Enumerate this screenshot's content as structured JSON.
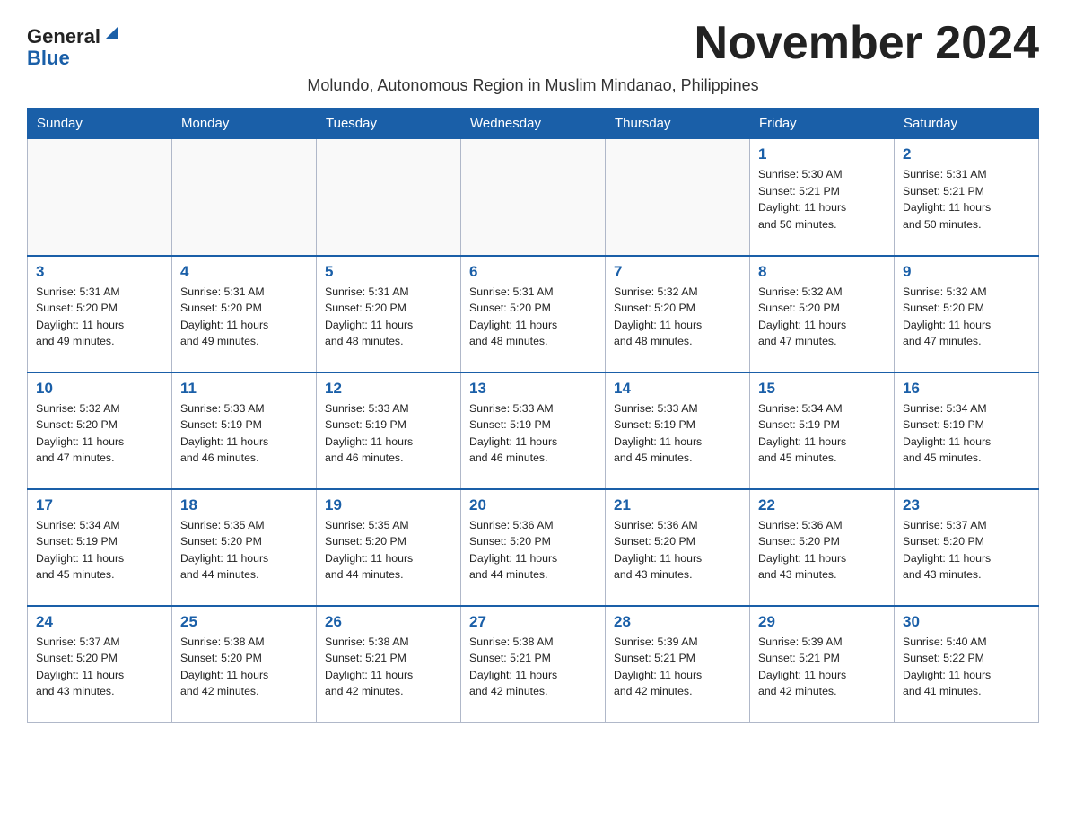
{
  "logo": {
    "general": "General",
    "blue": "Blue",
    "aria": "GeneralBlue logo"
  },
  "title": "November 2024",
  "subtitle": "Molundo, Autonomous Region in Muslim Mindanao, Philippines",
  "days_of_week": [
    "Sunday",
    "Monday",
    "Tuesday",
    "Wednesday",
    "Thursday",
    "Friday",
    "Saturday"
  ],
  "weeks": [
    {
      "days": [
        {
          "num": "",
          "info": ""
        },
        {
          "num": "",
          "info": ""
        },
        {
          "num": "",
          "info": ""
        },
        {
          "num": "",
          "info": ""
        },
        {
          "num": "",
          "info": ""
        },
        {
          "num": "1",
          "info": "Sunrise: 5:30 AM\nSunset: 5:21 PM\nDaylight: 11 hours\nand 50 minutes."
        },
        {
          "num": "2",
          "info": "Sunrise: 5:31 AM\nSunset: 5:21 PM\nDaylight: 11 hours\nand 50 minutes."
        }
      ]
    },
    {
      "days": [
        {
          "num": "3",
          "info": "Sunrise: 5:31 AM\nSunset: 5:20 PM\nDaylight: 11 hours\nand 49 minutes."
        },
        {
          "num": "4",
          "info": "Sunrise: 5:31 AM\nSunset: 5:20 PM\nDaylight: 11 hours\nand 49 minutes."
        },
        {
          "num": "5",
          "info": "Sunrise: 5:31 AM\nSunset: 5:20 PM\nDaylight: 11 hours\nand 48 minutes."
        },
        {
          "num": "6",
          "info": "Sunrise: 5:31 AM\nSunset: 5:20 PM\nDaylight: 11 hours\nand 48 minutes."
        },
        {
          "num": "7",
          "info": "Sunrise: 5:32 AM\nSunset: 5:20 PM\nDaylight: 11 hours\nand 48 minutes."
        },
        {
          "num": "8",
          "info": "Sunrise: 5:32 AM\nSunset: 5:20 PM\nDaylight: 11 hours\nand 47 minutes."
        },
        {
          "num": "9",
          "info": "Sunrise: 5:32 AM\nSunset: 5:20 PM\nDaylight: 11 hours\nand 47 minutes."
        }
      ]
    },
    {
      "days": [
        {
          "num": "10",
          "info": "Sunrise: 5:32 AM\nSunset: 5:20 PM\nDaylight: 11 hours\nand 47 minutes."
        },
        {
          "num": "11",
          "info": "Sunrise: 5:33 AM\nSunset: 5:19 PM\nDaylight: 11 hours\nand 46 minutes."
        },
        {
          "num": "12",
          "info": "Sunrise: 5:33 AM\nSunset: 5:19 PM\nDaylight: 11 hours\nand 46 minutes."
        },
        {
          "num": "13",
          "info": "Sunrise: 5:33 AM\nSunset: 5:19 PM\nDaylight: 11 hours\nand 46 minutes."
        },
        {
          "num": "14",
          "info": "Sunrise: 5:33 AM\nSunset: 5:19 PM\nDaylight: 11 hours\nand 45 minutes."
        },
        {
          "num": "15",
          "info": "Sunrise: 5:34 AM\nSunset: 5:19 PM\nDaylight: 11 hours\nand 45 minutes."
        },
        {
          "num": "16",
          "info": "Sunrise: 5:34 AM\nSunset: 5:19 PM\nDaylight: 11 hours\nand 45 minutes."
        }
      ]
    },
    {
      "days": [
        {
          "num": "17",
          "info": "Sunrise: 5:34 AM\nSunset: 5:19 PM\nDaylight: 11 hours\nand 45 minutes."
        },
        {
          "num": "18",
          "info": "Sunrise: 5:35 AM\nSunset: 5:20 PM\nDaylight: 11 hours\nand 44 minutes."
        },
        {
          "num": "19",
          "info": "Sunrise: 5:35 AM\nSunset: 5:20 PM\nDaylight: 11 hours\nand 44 minutes."
        },
        {
          "num": "20",
          "info": "Sunrise: 5:36 AM\nSunset: 5:20 PM\nDaylight: 11 hours\nand 44 minutes."
        },
        {
          "num": "21",
          "info": "Sunrise: 5:36 AM\nSunset: 5:20 PM\nDaylight: 11 hours\nand 43 minutes."
        },
        {
          "num": "22",
          "info": "Sunrise: 5:36 AM\nSunset: 5:20 PM\nDaylight: 11 hours\nand 43 minutes."
        },
        {
          "num": "23",
          "info": "Sunrise: 5:37 AM\nSunset: 5:20 PM\nDaylight: 11 hours\nand 43 minutes."
        }
      ]
    },
    {
      "days": [
        {
          "num": "24",
          "info": "Sunrise: 5:37 AM\nSunset: 5:20 PM\nDaylight: 11 hours\nand 43 minutes."
        },
        {
          "num": "25",
          "info": "Sunrise: 5:38 AM\nSunset: 5:20 PM\nDaylight: 11 hours\nand 42 minutes."
        },
        {
          "num": "26",
          "info": "Sunrise: 5:38 AM\nSunset: 5:21 PM\nDaylight: 11 hours\nand 42 minutes."
        },
        {
          "num": "27",
          "info": "Sunrise: 5:38 AM\nSunset: 5:21 PM\nDaylight: 11 hours\nand 42 minutes."
        },
        {
          "num": "28",
          "info": "Sunrise: 5:39 AM\nSunset: 5:21 PM\nDaylight: 11 hours\nand 42 minutes."
        },
        {
          "num": "29",
          "info": "Sunrise: 5:39 AM\nSunset: 5:21 PM\nDaylight: 11 hours\nand 42 minutes."
        },
        {
          "num": "30",
          "info": "Sunrise: 5:40 AM\nSunset: 5:22 PM\nDaylight: 11 hours\nand 41 minutes."
        }
      ]
    }
  ]
}
